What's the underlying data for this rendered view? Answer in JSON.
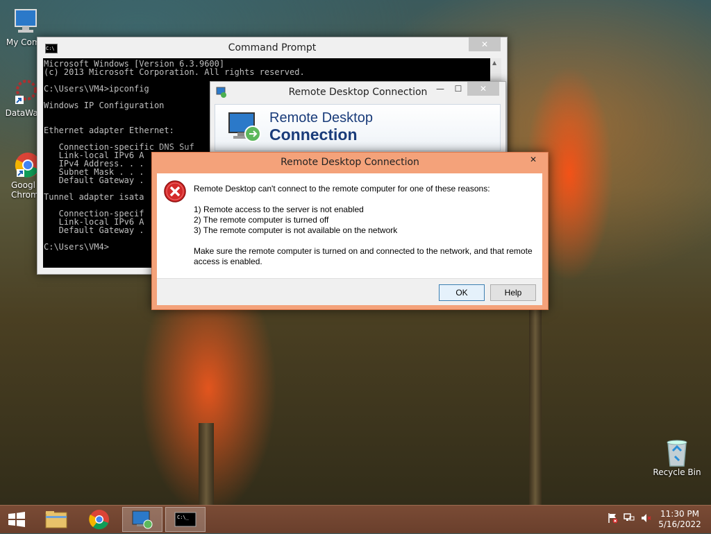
{
  "desktop": {
    "icons": [
      {
        "label": "My Comp"
      },
      {
        "label": "DataWag"
      },
      {
        "label": "Googl Chrom"
      },
      {
        "label": "Recycle Bin"
      }
    ]
  },
  "cmd": {
    "title": "Command Prompt",
    "lines": [
      "Microsoft Windows [Version 6.3.9600]",
      "(c) 2013 Microsoft Corporation. All rights reserved.",
      "",
      "C:\\Users\\VM4>ipconfig",
      "",
      "Windows IP Configuration",
      "",
      "",
      "Ethernet adapter Ethernet:",
      "",
      "   Connection-specific DNS Suf",
      "   Link-local IPv6 A",
      "   IPv4 Address. . .",
      "   Subnet Mask . . .",
      "   Default Gateway .",
      "",
      "Tunnel adapter isata",
      "",
      "   Connection-specif",
      "   Link-local IPv6 A",
      "   Default Gateway .",
      "",
      "C:\\Users\\VM4>"
    ]
  },
  "rdc": {
    "title": "Remote Desktop Connection",
    "banner_line1": "Remote Desktop",
    "banner_line2": "Connection"
  },
  "error_dialog": {
    "title": "Remote Desktop Connection",
    "intro": "Remote Desktop can't connect to the remote computer for one of these reasons:",
    "reasons": [
      "1) Remote access to the server is not enabled",
      "2) The remote computer is turned off",
      "3) The remote computer is not available on the network"
    ],
    "advice_line1": "Make sure the remote computer is turned on and connected to the network, and that remote",
    "advice_line2": "access is enabled.",
    "ok_label": "OK",
    "help_label": "Help"
  },
  "taskbar": {
    "time": "11:30 PM",
    "date": "5/16/2022"
  },
  "colors": {
    "error_frame": "#f4a27a",
    "taskbar": "#6a3f2c",
    "accent_blue": "#1a3c7a"
  }
}
